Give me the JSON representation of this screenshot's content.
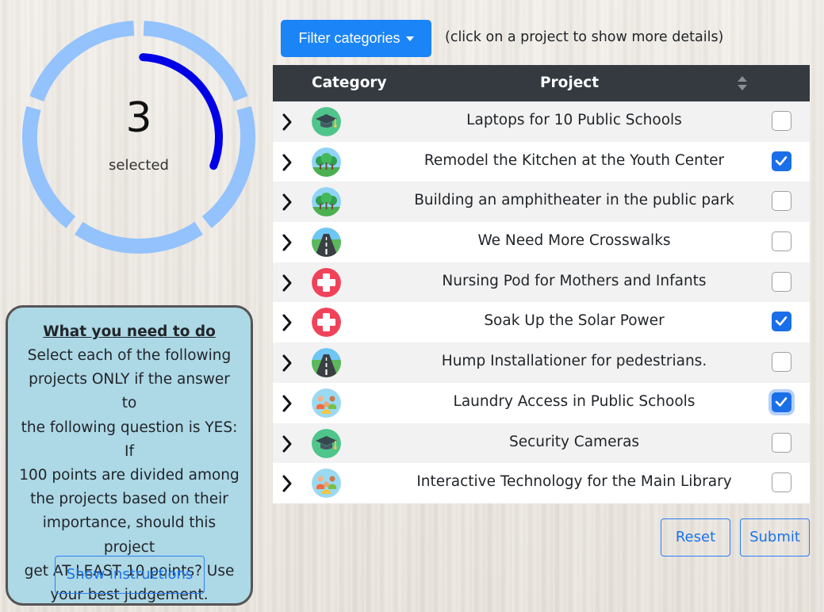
{
  "progress": {
    "count": "3",
    "label": "selected",
    "fraction": 0.3,
    "colors": {
      "ring": "#93c2fc",
      "arc": "#0000e6"
    }
  },
  "instructions": {
    "title": "What you need to do",
    "lines": [
      "Select each of the following",
      "projects ONLY if the answer to",
      "the following question is YES: If",
      "100 points are divided among",
      "the projects based on their",
      "importance, should this project",
      "get AT LEAST 10 points? Use",
      "your best judgement."
    ],
    "button_label": "Show instructions"
  },
  "filter": {
    "label": "Filter categories"
  },
  "hint": "(click on a project to show more details)",
  "table": {
    "headers": {
      "category": "Category",
      "project": "Project"
    },
    "rows": [
      {
        "project": "Laptops for 10 Public Schools",
        "category_icon": "graduation-cap-icon",
        "checked": false
      },
      {
        "project": "Remodel the Kitchen at the Youth Center",
        "category_icon": "park-trees-icon",
        "checked": true
      },
      {
        "project": "Building an amphitheater in the public park",
        "category_icon": "park-trees-icon",
        "checked": false
      },
      {
        "project": "We Need More Crosswalks",
        "category_icon": "road-icon",
        "checked": false
      },
      {
        "project": "Nursing Pod for Mothers and Infants",
        "category_icon": "medical-cross-icon",
        "checked": false
      },
      {
        "project": "Soak Up the Solar Power",
        "category_icon": "medical-cross-icon",
        "checked": true
      },
      {
        "project": "Hump Installationer for pedestrians.",
        "category_icon": "road-icon",
        "checked": false
      },
      {
        "project": "Laundry Access in Public Schools",
        "category_icon": "community-people-icon",
        "checked": true
      },
      {
        "project": "Security Cameras",
        "category_icon": "graduation-cap-icon",
        "checked": false
      },
      {
        "project": "Interactive Technology for the Main Library",
        "category_icon": "community-people-icon",
        "checked": false
      }
    ]
  },
  "actions": {
    "reset": "Reset",
    "submit": "Submit"
  }
}
